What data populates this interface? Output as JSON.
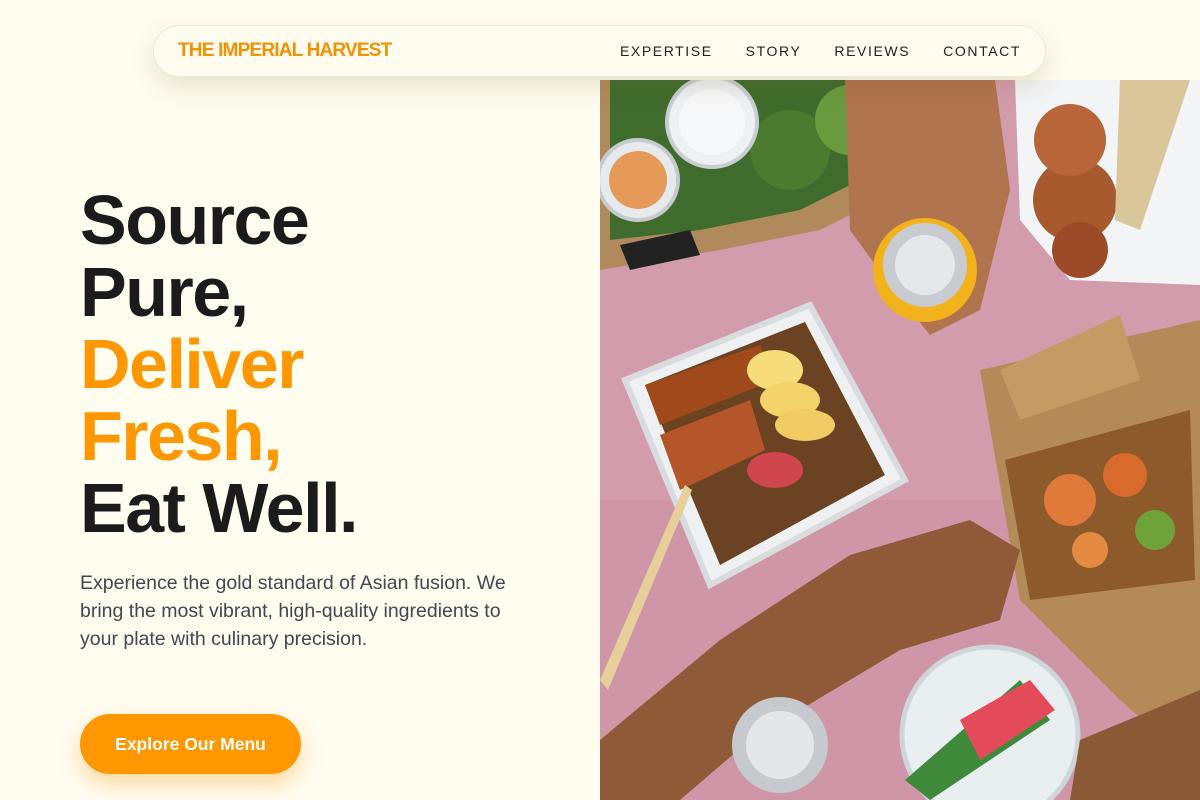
{
  "nav": {
    "brand": "THE IMPERIAL HARVEST",
    "links": [
      {
        "label": "EXPERTISE"
      },
      {
        "label": "STORY"
      },
      {
        "label": "REVIEWS"
      },
      {
        "label": "CONTACT"
      }
    ]
  },
  "hero": {
    "headline": {
      "line1": "Source",
      "line2": "Pure,",
      "line3": "Deliver",
      "line4": "Fresh,",
      "line5": "Eat Well."
    },
    "description": "Experience the gold standard of Asian fusion. We bring the most vibrant, high-quality ingredients to your plate with culinary precision.",
    "cta_label": "Explore Our Menu"
  },
  "colors": {
    "accent": "#ff9800",
    "background": "#fffcf0",
    "text": "#1b1b1b",
    "muted_text": "#444650"
  }
}
